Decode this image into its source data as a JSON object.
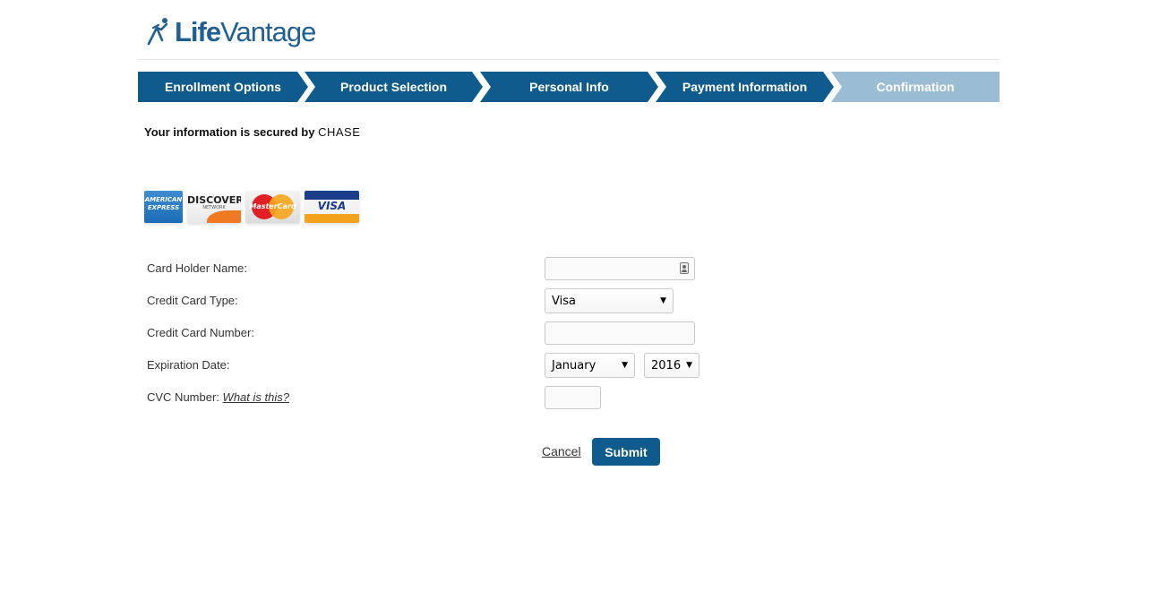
{
  "brand": {
    "name_bold": "Life",
    "name_rest": "Vantage",
    "color": "#1f5f91"
  },
  "steps": [
    {
      "label": "Enrollment Options",
      "active": true
    },
    {
      "label": "Product Selection",
      "active": true
    },
    {
      "label": "Personal Info",
      "active": true
    },
    {
      "label": "Payment Information",
      "active": true
    },
    {
      "label": "Confirmation",
      "active": false
    }
  ],
  "colors": {
    "step_active": "#0f5b8e",
    "step_inactive": "#9bbdd3",
    "submit": "#0f5b8e"
  },
  "secure_notice": {
    "text": "Your information is secured by ",
    "provider": "CHASE"
  },
  "card_logos": {
    "amex": "AMERICAN EXPRESS",
    "discover": "DISCOVER",
    "discover_sub": "NETWORK",
    "mastercard": "MasterCard",
    "visa": "VISA"
  },
  "form": {
    "card_holder_label": "Card Holder Name:",
    "card_holder_value": "",
    "card_type_label": "Credit Card Type:",
    "card_type_value": "Visa",
    "card_number_label": "Credit Card Number:",
    "card_number_value": "",
    "expiration_label": "Expiration Date:",
    "expiration_month": "January",
    "expiration_year": "2016",
    "cvc_label": "CVC Number:",
    "cvc_help_link": "What is this?",
    "cvc_value": ""
  },
  "actions": {
    "cancel": "Cancel",
    "submit": "Submit"
  }
}
